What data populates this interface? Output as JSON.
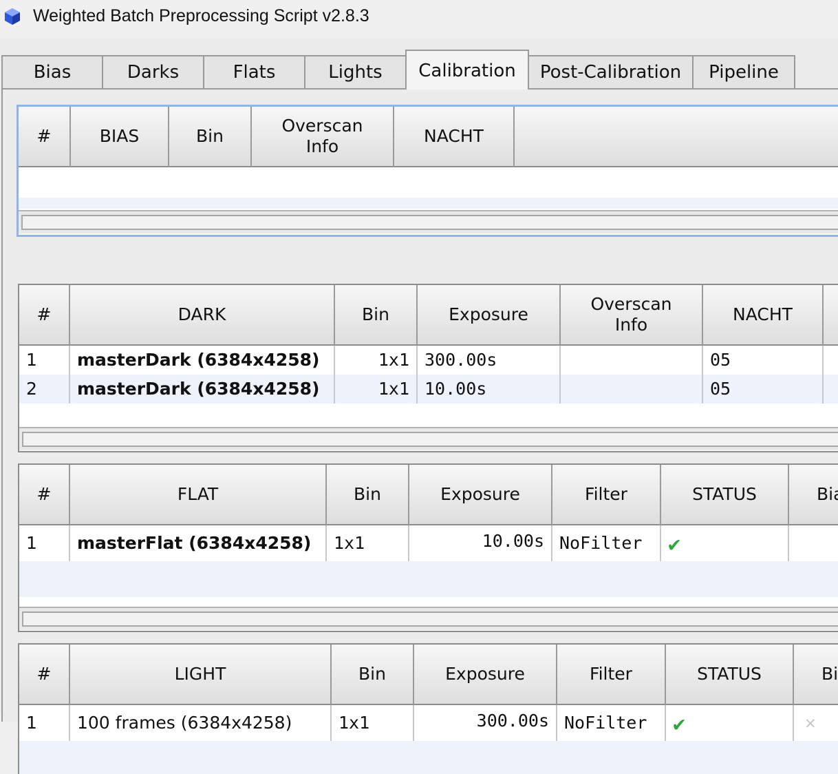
{
  "window": {
    "title": "Weighted Batch Preprocessing Script v2.8.3"
  },
  "tabs": [
    {
      "label": "Bias"
    },
    {
      "label": "Darks"
    },
    {
      "label": "Flats"
    },
    {
      "label": "Lights"
    },
    {
      "label": "Calibration",
      "active": true
    },
    {
      "label": "Post-Calibration"
    },
    {
      "label": "Pipeline"
    }
  ],
  "bias_table": {
    "headers": [
      "#",
      "BIAS",
      "Bin",
      "Overscan",
      "Info",
      "NACHT"
    ],
    "rows": []
  },
  "dark_table": {
    "headers": [
      "#",
      "DARK",
      "Bin",
      "Exposure",
      "Overscan",
      "Info",
      "NACHT"
    ],
    "rows": [
      {
        "index": "1",
        "name": "masterDark (6384x4258)",
        "bin": "1x1",
        "exposure": "300.00s",
        "overscan": "",
        "nacht": "05"
      },
      {
        "index": "2",
        "name": "masterDark (6384x4258)",
        "bin": "1x1",
        "exposure": "10.00s",
        "overscan": "",
        "nacht": "05"
      }
    ]
  },
  "flat_table": {
    "headers": [
      "#",
      "FLAT",
      "Bin",
      "Exposure",
      "Filter",
      "STATUS",
      "Bia"
    ],
    "rows": [
      {
        "index": "1",
        "name": "masterFlat (6384x4258)",
        "bin": "1x1",
        "exposure": "10.00s",
        "filter": "NoFilter",
        "status": "✔"
      }
    ]
  },
  "light_table": {
    "headers": [
      "#",
      "LIGHT",
      "Bin",
      "Exposure",
      "Filter",
      "STATUS",
      "Bi"
    ],
    "rows": [
      {
        "index": "1",
        "name": "100 frames (6384x4258)",
        "bin": "1x1",
        "exposure": "300.00s",
        "filter": "NoFilter",
        "status": "✔",
        "bias_status": "✕"
      }
    ]
  },
  "colors": {
    "accent_focus": "#8fb5e8",
    "check_green": "#2fa63a",
    "row_alt": "#eef2fa"
  }
}
